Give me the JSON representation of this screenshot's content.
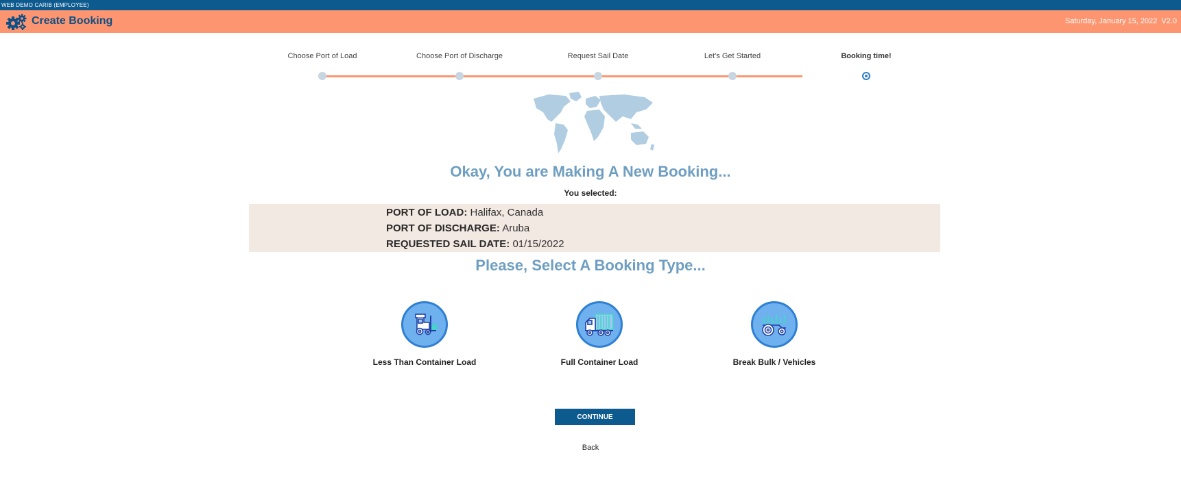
{
  "header": {
    "top_strip": "WEB DEMO CARIB (EMPLOYEE)",
    "title": "Create Booking",
    "logo_icon": "gears-icon",
    "date": "Saturday, January 15, 2022",
    "version": "V2.0"
  },
  "steps": [
    {
      "label": "Choose Port of Load",
      "active": false
    },
    {
      "label": "Choose Port of Discharge",
      "active": false
    },
    {
      "label": "Request Sail Date",
      "active": false
    },
    {
      "label": "Let's Get Started",
      "active": false
    },
    {
      "label": "Booking time!",
      "active": true
    }
  ],
  "main": {
    "headline": "Okay, You are Making A New Booking...",
    "selected_label": "You selected:",
    "summary": {
      "port_of_load_label": "PORT OF LOAD:",
      "port_of_load": "Halifax, Canada",
      "port_of_discharge_label": "PORT OF DISCHARGE:",
      "port_of_discharge": "Aruba",
      "sail_date_label": "REQUESTED SAIL DATE:",
      "sail_date": "01/15/2022"
    },
    "select_type_headline": "Please, Select A Booking Type...",
    "booking_types": [
      {
        "label": "Less Than Container Load",
        "icon": "forklift-icon"
      },
      {
        "label": "Full Container Load",
        "icon": "container-truck-icon"
      },
      {
        "label": "Break Bulk / Vehicles",
        "icon": "tractor-icon"
      }
    ],
    "continue_label": "CONTINUE",
    "back_label": "Back"
  },
  "colors": {
    "header_bg": "#fd9570",
    "top_strip_bg": "#0d5a8f",
    "headline": "#6e9ec1",
    "summary_bg": "#f3e9e3",
    "button_bg": "#0d5a8f",
    "icon_circle": "#6fb0ee"
  }
}
